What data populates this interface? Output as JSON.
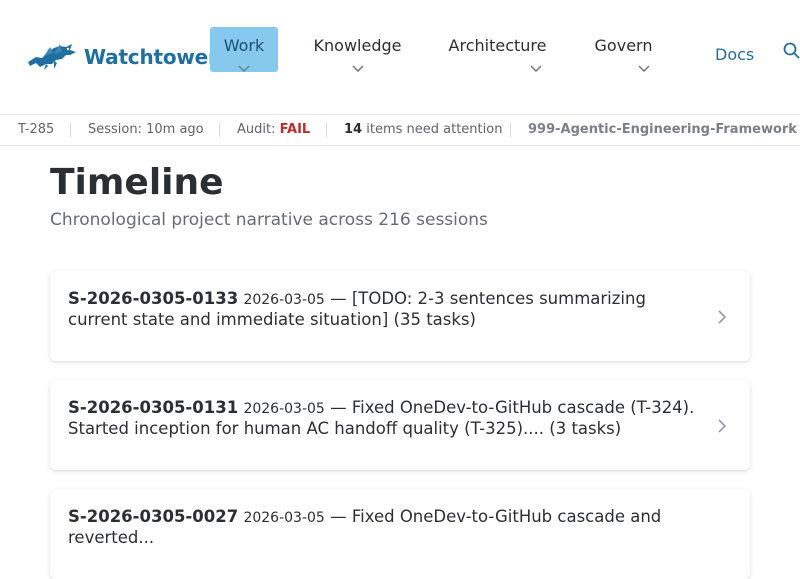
{
  "brand": {
    "name": "Watchtower",
    "icon": "dragon-logo-icon"
  },
  "nav": {
    "items": [
      {
        "label": "Work",
        "active": true
      },
      {
        "label": "Knowledge",
        "active": false
      },
      {
        "label": "Architecture",
        "active": false
      },
      {
        "label": "Govern",
        "active": false
      }
    ],
    "docs_label": "Docs",
    "search_icon": "search-icon"
  },
  "status": {
    "task": "T-285",
    "session": "Session: 10m ago",
    "audit_label": "Audit:",
    "audit_value": "FAIL",
    "attention_count": "14",
    "attention_text": "items need attention",
    "project": "999-Agentic-Engineering-Framework"
  },
  "colors": {
    "accent": "#1f6fa3",
    "active_nav_bg": "#87c8ee",
    "fail": "#c62828"
  },
  "page": {
    "title": "Timeline",
    "subtitle": "Chronological project narrative across 216 sessions"
  },
  "timeline": [
    {
      "id": "S-2026-0305-0133",
      "date": "2026-03-05",
      "text": "— [TODO: 2-3 sentences summarizing current state and immediate situation] (35 tasks)"
    },
    {
      "id": "S-2026-0305-0131",
      "date": "2026-03-05",
      "text": "— Fixed OneDev-to-GitHub cascade (T-324). Started inception for human AC handoff quality (T-325).... (3 tasks)"
    },
    {
      "id": "S-2026-0305-0027",
      "date": "2026-03-05",
      "text": "— Fixed OneDev-to-GitHub cascade and reverted..."
    }
  ]
}
